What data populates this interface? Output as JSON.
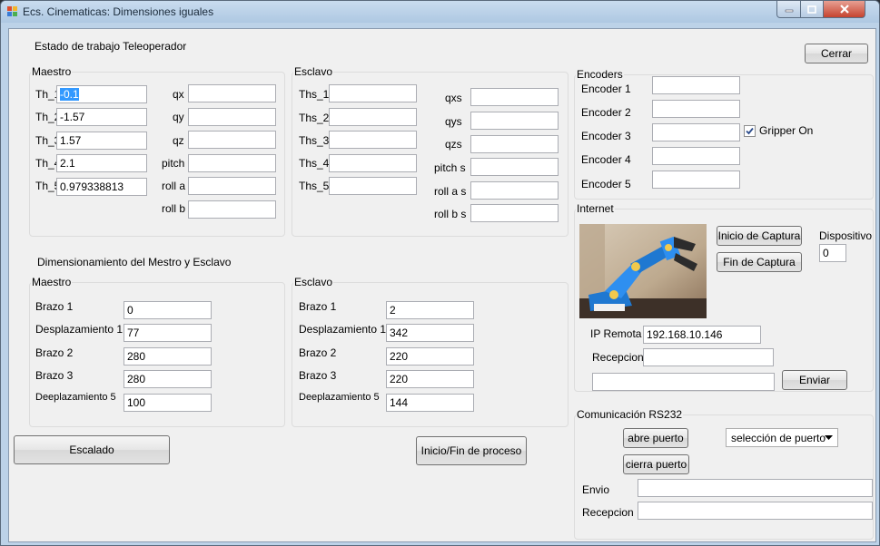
{
  "window": {
    "title": "Ecs. Cinematicas: Dimensiones iguales"
  },
  "status_title": "Estado de trabajo Teleoperador",
  "close_button": "Cerrar",
  "maestro": {
    "title": "Maestro",
    "th_labels": [
      "Th_1",
      "Th_2",
      "Th_3",
      "Th_4",
      "Th_5"
    ],
    "th_values": [
      "-0.1",
      "-1.57",
      "1.57",
      "2.1",
      "0.979338813"
    ],
    "pose_labels": [
      "qx",
      "qy",
      "qz",
      "pitch",
      "roll a",
      "roll b"
    ],
    "pose_values": [
      "",
      "",
      "",
      "",
      "",
      ""
    ]
  },
  "esclavo": {
    "title": "Esclavo",
    "ths_labels": [
      "Ths_1",
      "Ths_2",
      "Ths_3",
      "Ths_4",
      "Ths_5"
    ],
    "ths_values": [
      "",
      "",
      "",
      "",
      ""
    ],
    "pose_labels": [
      "qxs",
      "qys",
      "qzs",
      "pitch s",
      "roll a s",
      "roll b s"
    ],
    "pose_values": [
      "",
      "",
      "",
      "",
      "",
      ""
    ]
  },
  "dimensioning_title": "Dimensionamiento del Mestro y Esclavo",
  "dim_maestro": {
    "title": "Maestro",
    "labels": [
      "Brazo 1",
      "Desplazamiento 1",
      "Brazo 2",
      "Brazo 3",
      "Deeplazamiento 5"
    ],
    "values": [
      "0",
      "77",
      "280",
      "280",
      "100"
    ]
  },
  "dim_esclavo": {
    "title": "Esclavo",
    "labels": [
      "Brazo 1",
      "Desplazamiento 1",
      "Brazo 2",
      "Brazo 3",
      "Deeplazamiento 5"
    ],
    "values": [
      "2",
      "342",
      "220",
      "220",
      "144"
    ]
  },
  "buttons": {
    "escalado": "Escalado",
    "inicio_fin": "Inicio/Fin de proceso"
  },
  "encoders": {
    "title": "Encoders",
    "labels": [
      "Encoder 1",
      "Encoder 2",
      "Encoder 3",
      "Encoder 4",
      "Encoder 5"
    ],
    "values": [
      "",
      "",
      "",
      "",
      ""
    ],
    "gripper_label": "Gripper On",
    "gripper_checked": true
  },
  "internet": {
    "title": "Internet",
    "start_capture": "Inicio de Captura",
    "end_capture": "Fin de Captura",
    "device_label": "Dispositivo",
    "device_value": "0",
    "ip_label": "IP Remota",
    "ip_value": "192.168.10.146",
    "reception_label": "Recepcion",
    "reception_value": "",
    "send_value": "",
    "send_button": "Enviar"
  },
  "rs232": {
    "title": "Comunicación RS232",
    "open_port": "abre puerto",
    "close_port": "cierra puerto",
    "port_select": "selección de puerto",
    "send_label": "Envio",
    "send_value": "",
    "reception_label": "Recepcion",
    "reception_value": ""
  },
  "icons": {
    "app": "app-icon",
    "minimize": "minimize-icon",
    "maximize": "maximize-icon",
    "close": "close-icon",
    "dropdown": "chevron-down-icon"
  }
}
